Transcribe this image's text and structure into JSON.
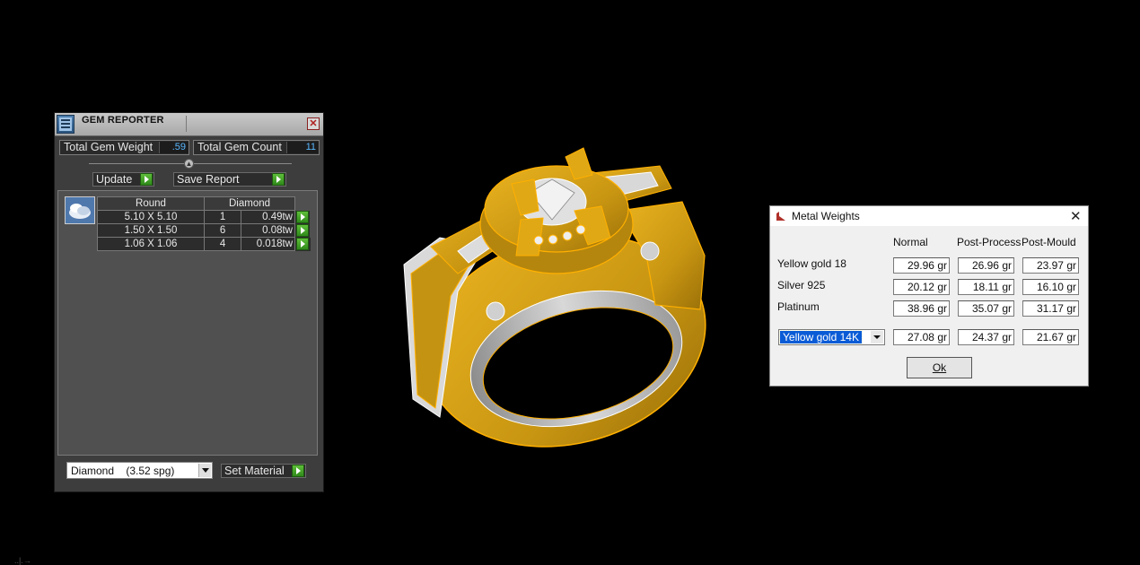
{
  "gem_reporter": {
    "title": "GEM REPORTER",
    "close": "✕",
    "total_weight_label": "Total Gem Weight",
    "total_weight_value": ".59",
    "total_count_label": "Total Gem Count",
    "total_count_value": "11",
    "collapse": "▲",
    "update_label": "Update",
    "save_report_label": "Save Report",
    "table": {
      "headers": [
        "Round",
        "Diamond"
      ],
      "rows": [
        {
          "size": "5.10 X 5.10",
          "count": "1",
          "weight": "0.49tw"
        },
        {
          "size": "1.50 X 1.50",
          "count": "6",
          "weight": "0.08tw"
        },
        {
          "size": "1.06 X 1.06",
          "count": "4",
          "weight": "0.018tw"
        }
      ]
    },
    "material_value": "Diamond    (3.52 spg)",
    "set_material_label": "Set Material"
  },
  "metal_weights": {
    "title": "Metal Weights",
    "close": "✕",
    "columns": [
      "Normal",
      "Post-Process",
      "Post-Mould"
    ],
    "rows": [
      {
        "name": "Yellow gold 18",
        "normal": "29.96 gr",
        "post_process": "26.96 gr",
        "post_mould": "23.97 gr"
      },
      {
        "name": "Silver 925",
        "normal": "20.12 gr",
        "post_process": "18.11 gr",
        "post_mould": "16.10 gr"
      },
      {
        "name": "Platinum",
        "normal": "38.96 gr",
        "post_process": "35.07 gr",
        "post_mould": "31.17 gr"
      }
    ],
    "custom": {
      "alloy": "Yellow gold 14K",
      "normal": "27.08 gr",
      "post_process": "24.37 gr",
      "post_mould": "21.67 gr"
    },
    "ok_label": "Ok"
  },
  "colors": {
    "gold": "#d4a017",
    "gold_outline": "#ffb000",
    "silver": "#c8c8c8",
    "accent_blue": "#59b7ff",
    "go_green": "#3fa022"
  },
  "corner_mark": "..|.→"
}
